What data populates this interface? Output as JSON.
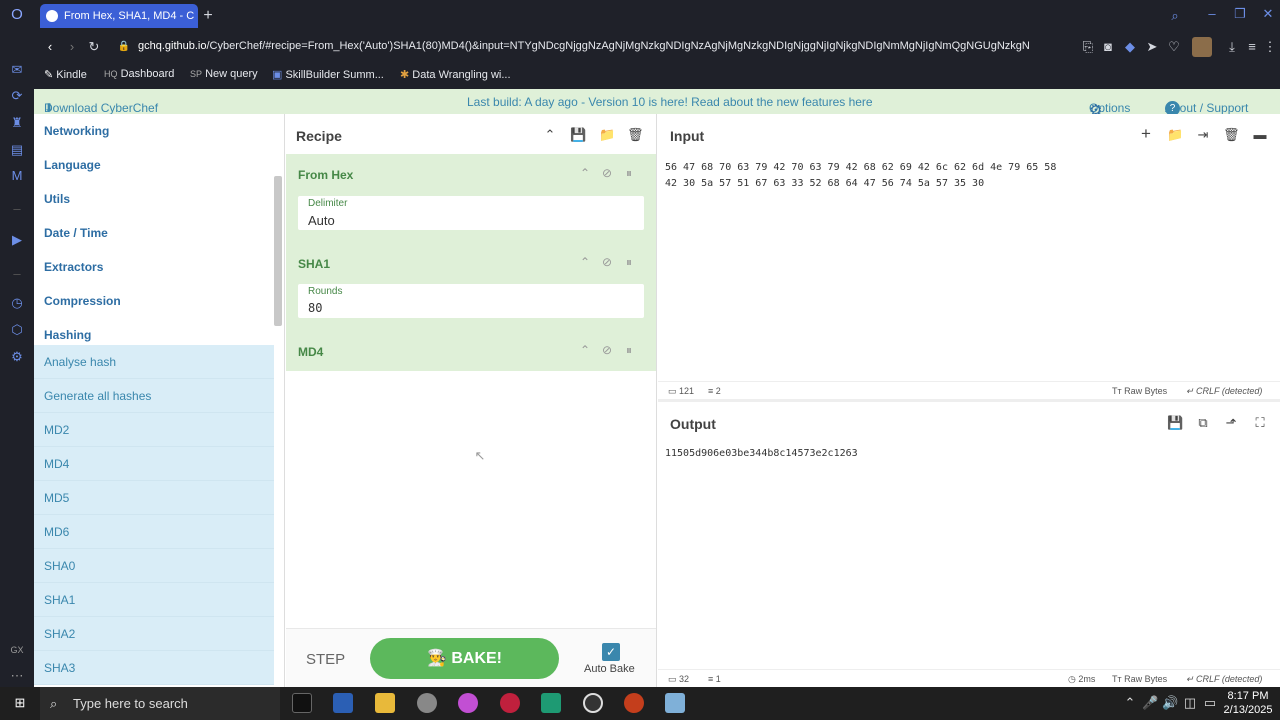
{
  "browser": {
    "tab_title": "From Hex, SHA1, MD4 - C",
    "url_host": "gchq.github.io",
    "url_rest": "/CyberChef/#recipe=From_Hex('Auto')SHA1(80)MD4()&input=NTYgNDcgNjggNzAgNjMgNzkgNDIgNzAgNjMgNzkgNDIgNjggNjIgNjkgNDIgNmMgNjIgNmQgNGUgNzkgN",
    "bookmarks": [
      {
        "badge": "",
        "label": "Kindle"
      },
      {
        "badge": "HQ",
        "label": "Dashboard"
      },
      {
        "badge": "SP",
        "label": "New query"
      },
      {
        "badge": "",
        "label": "SkillBuilder Summ..."
      },
      {
        "badge": "",
        "label": "Data Wrangling wi..."
      }
    ]
  },
  "banner": {
    "download": "Download CyberChef",
    "message": "Last build: A day ago - Version 10 is here! Read about the new features here",
    "options": "Options",
    "about": "About / Support"
  },
  "operations": {
    "categories": [
      "Networking",
      "Language",
      "Utils",
      "Date / Time",
      "Extractors",
      "Compression",
      "Hashing"
    ],
    "items": [
      "Analyse hash",
      "Generate all hashes",
      "MD2",
      "MD4",
      "MD5",
      "MD6",
      "SHA0",
      "SHA1",
      "SHA2",
      "SHA3"
    ]
  },
  "recipe": {
    "title": "Recipe",
    "ops": [
      {
        "name": "From Hex",
        "arg_label": "Delimiter",
        "arg_value": "Auto"
      },
      {
        "name": "SHA1",
        "arg_label": "Rounds",
        "arg_value": "80"
      },
      {
        "name": "MD4"
      }
    ],
    "step": "STEP",
    "bake": "BAKE!",
    "auto_bake": "Auto Bake"
  },
  "input": {
    "title": "Input",
    "line1": "56 47 68 70 63 79 42 70 63 79 42 68 62 69 42 6c 62 6d 4e 79 65 58",
    "line2": "42 30 5a 57 51 67 63 33 52 68 64 47 56 74 5a 57 35 30",
    "length": "121",
    "lines": "2",
    "encoding": "Raw Bytes",
    "eol": "CRLF (detected)"
  },
  "output": {
    "title": "Output",
    "value": "11505d906e03be344b8c14573e2c1263",
    "length": "32",
    "lines": "1",
    "time": "2ms",
    "encoding": "Raw Bytes",
    "eol": "CRLF (detected)"
  },
  "taskbar": {
    "search_placeholder": "Type here to search",
    "time": "8:17 PM",
    "date": "2/13/2025"
  },
  "colors": {
    "recipe_green": "#dff0d8",
    "ops_blue": "#d9edf7",
    "bake_green": "#5cb85c",
    "browser_tab": "#3b5fd6"
  }
}
